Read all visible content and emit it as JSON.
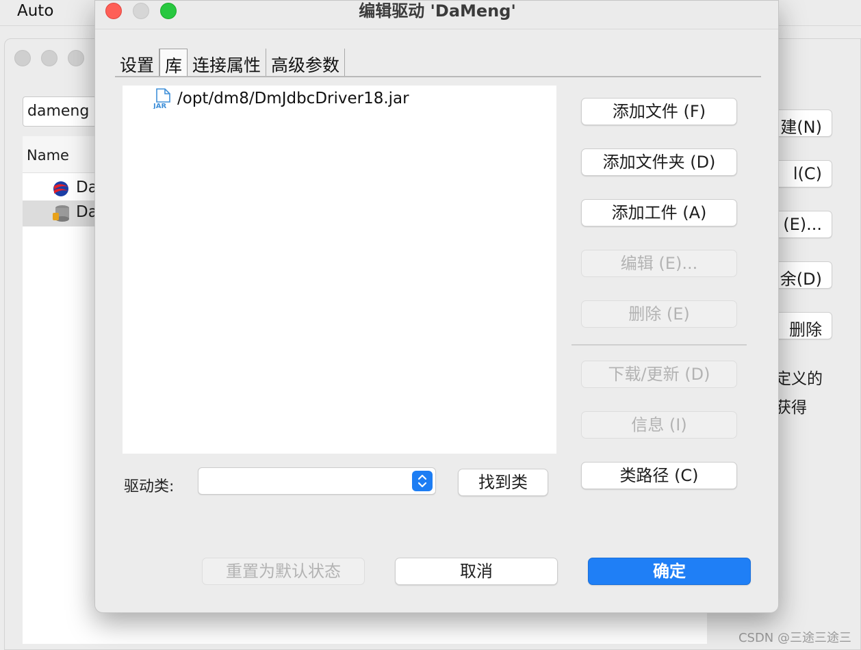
{
  "background": {
    "app_title": "Auto",
    "search_value": "dameng",
    "list_header": "Name",
    "rows": [
      "Da",
      "Da"
    ],
    "buttons": [
      "建(N)",
      "l(C)",
      "(E)...",
      "余(D)",
      "删除"
    ],
    "note_lines": [
      "定义的",
      "获得"
    ]
  },
  "dialog": {
    "title": "编辑驱动 'DaMeng'",
    "tabs": [
      {
        "label": "设置",
        "active": false
      },
      {
        "label": "库",
        "active": true
      },
      {
        "label": "连接属性",
        "active": false
      },
      {
        "label": "高级参数",
        "active": false
      }
    ],
    "library_items": [
      {
        "icon": "jar-file-icon",
        "path": "/opt/dm8/DmJdbcDriver18.jar"
      }
    ],
    "driver_class_label": "驱动类:",
    "driver_class_value": "",
    "find_class_label": "找到类",
    "side_buttons": [
      {
        "label": "添加文件 (F)",
        "enabled": true
      },
      {
        "label": "添加文件夹 (D)",
        "enabled": true
      },
      {
        "label": "添加工件 (A)",
        "enabled": true
      },
      {
        "label": "编辑 (E)...",
        "enabled": false
      },
      {
        "label": "删除 (E)",
        "enabled": false
      },
      {
        "label": "下载/更新 (D)",
        "enabled": false
      },
      {
        "label": "信息 (I)",
        "enabled": false
      },
      {
        "label": "类路径 (C)",
        "enabled": true
      }
    ],
    "footer": {
      "reset_label": "重置为默认状态",
      "cancel_label": "取消",
      "ok_label": "确定"
    }
  },
  "watermark": "CSDN @三途三途三"
}
